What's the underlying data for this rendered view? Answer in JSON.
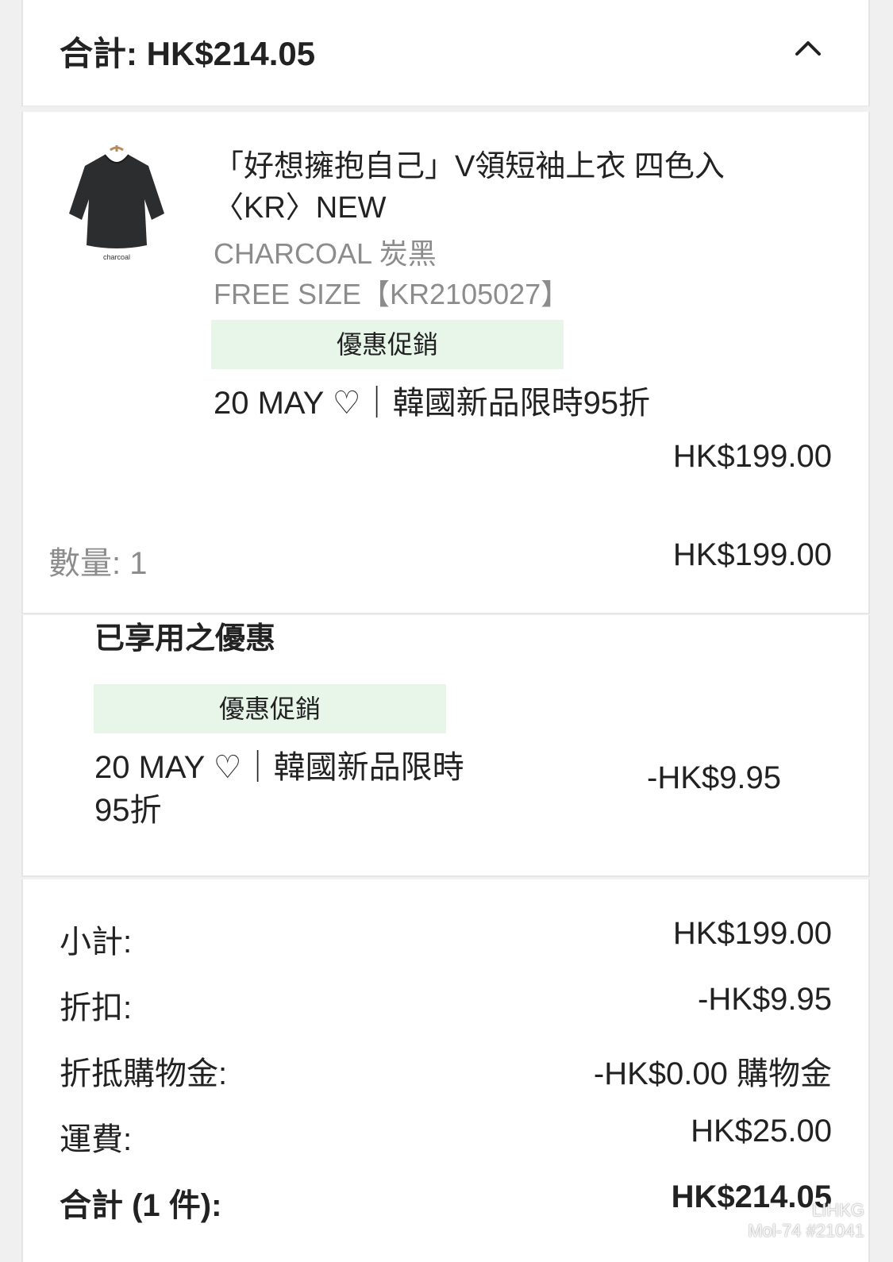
{
  "header": {
    "title": "合計: HK$214.05"
  },
  "item": {
    "name": "「好想擁抱自己」V領短袖上衣 四色入〈KR〉NEW",
    "color": "CHARCOAL 炭黑",
    "size": "FREE SIZE【KR2105027】",
    "thumb_label": "charcoal",
    "promo_tag": "優惠促銷",
    "promo_text": "20 MAY ♡｜韓國新品限時95折",
    "unit_price": "HK$199.00",
    "qty_label": "數量: 1",
    "line_total": "HK$199.00"
  },
  "applied": {
    "heading": "已享用之優惠",
    "promo_tag": "優惠促銷",
    "promo_text_1": "20 MAY ♡｜韓國新品限時",
    "promo_text_2": "95折",
    "amount": "-HK$9.95"
  },
  "summary": {
    "rows": [
      {
        "label": "小計:",
        "value": "HK$199.00"
      },
      {
        "label": "折扣:",
        "value": "-HK$9.95"
      },
      {
        "label": "折抵購物金:",
        "value": "-HK$0.00 購物金"
      },
      {
        "label": "運費:",
        "value": "HK$25.00"
      },
      {
        "label": "合計 (1 件):",
        "value": "HK$214.05"
      }
    ]
  },
  "watermark": {
    "line1": "LIHKG",
    "line2": "Mol-74 #21041"
  },
  "colors": {
    "promo_bg": "#e8f6ea",
    "muted_text": "#8c8c8c"
  }
}
